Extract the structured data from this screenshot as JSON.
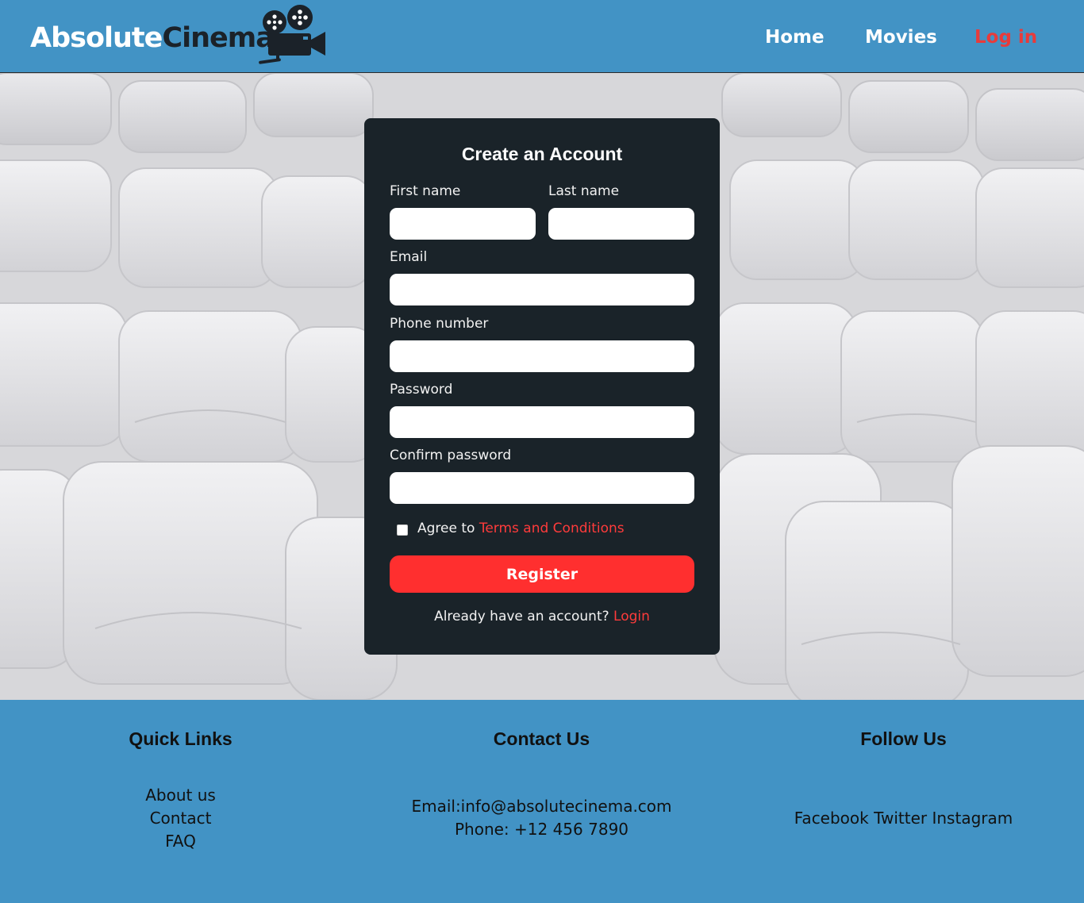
{
  "header": {
    "logo_part1": "Absolute",
    "logo_part2": "Cinema",
    "logo_icon": "film-camera-icon",
    "nav": {
      "home": "Home",
      "movies": "Movies",
      "login": "Log in"
    }
  },
  "form": {
    "title": "Create an Account",
    "first_name_label": "First name",
    "last_name_label": "Last name",
    "email_label": "Email",
    "phone_label": "Phone number",
    "password_label": "Password",
    "confirm_password_label": "Confirm password",
    "first_name_value": "",
    "last_name_value": "",
    "email_value": "",
    "phone_value": "",
    "password_value": "",
    "confirm_password_value": "",
    "agree_prefix": "Agree to ",
    "terms_link": "Terms and Conditions",
    "register_button": "Register",
    "already_text": "Already have an account? ",
    "login_link": "Login"
  },
  "footer": {
    "quick_links": {
      "title": "Quick Links",
      "items": [
        "About us",
        "Contact",
        "FAQ"
      ]
    },
    "contact": {
      "title": "Contact Us",
      "email": "Email:info@absolutecinema.com",
      "phone": "Phone: +12 456 7890"
    },
    "follow": {
      "title": "Follow Us",
      "text": "Facebook Twitter Instagram"
    }
  },
  "colors": {
    "header_bg": "#4293c5",
    "card_bg": "#1a2329",
    "accent_red": "#ff2f2f",
    "link_red": "#e83b3b"
  }
}
